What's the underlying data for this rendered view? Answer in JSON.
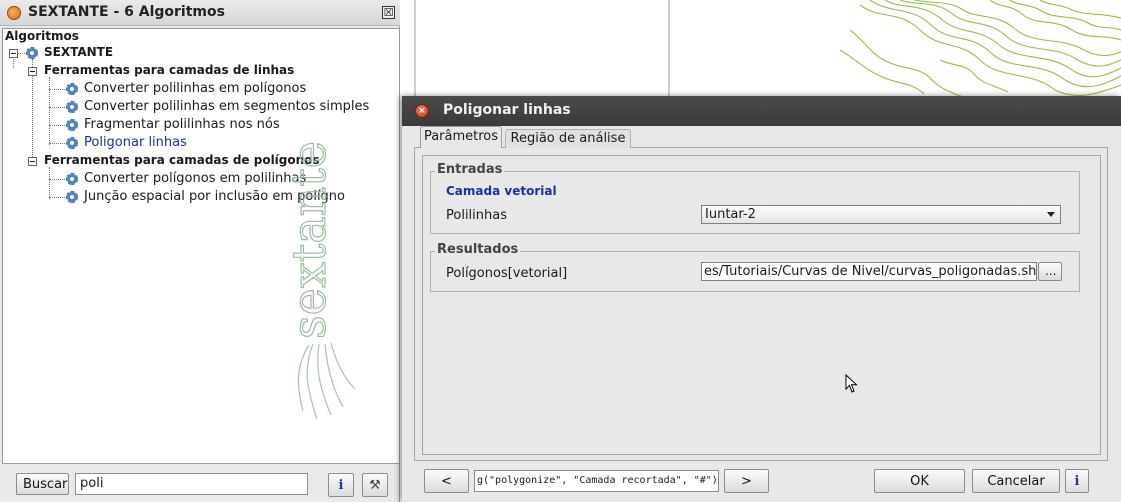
{
  "left_panel": {
    "title": "SEXTANTE - 6 Algoritmos",
    "close_glyph": "☒",
    "tree_header": "Algoritmos",
    "root": "SEXTANTE",
    "groups": [
      {
        "label": "Ferramentas para camadas de linhas",
        "items": [
          {
            "label": "Converter polilinhas em polígonos",
            "selected": false
          },
          {
            "label": "Converter polilinhas em segmentos simples",
            "selected": false
          },
          {
            "label": "Fragmentar polilinhas nos nós",
            "selected": false
          },
          {
            "label": "Poligonar linhas",
            "selected": true
          }
        ]
      },
      {
        "label": "Ferramentas para camadas de polígonos",
        "items": [
          {
            "label": "Converter polígonos em polilinhas",
            "selected": false
          },
          {
            "label": "Junção espacial por inclusão em polígno",
            "selected": false
          }
        ]
      }
    ],
    "watermark": "sextante",
    "search_button": "Buscar",
    "search_value": "poli",
    "info_glyph": "i",
    "tools_glyph": "⚒"
  },
  "dialog": {
    "title": "Poligonar linhas",
    "close_glyph": "×",
    "tabs": [
      "Parâmetros",
      "Região de análise"
    ],
    "inputs_group": "Entradas",
    "layer_subtitle": "Camada vetorial",
    "polylines_label": "Polilinhas",
    "polylines_value": "Iuntar-2",
    "results_group": "Resultados",
    "polygons_label": "Polígonos[vetorial]",
    "output_path": "es/Tutoriais/Curvas de Nivel/curvas_poligonadas.shp",
    "browse_label": "...",
    "prev_label": "<",
    "command_text": "g(\"polygonize\", \"Camada recortada\", \"#\")",
    "next_label": ">",
    "ok_label": "OK",
    "cancel_label": "Cancelar",
    "info_glyph": "i"
  },
  "colors": {
    "selected_item": "#1a2fa8",
    "titlebar_dark": "#3d3d3d",
    "contour_green": "#8bc34a"
  }
}
